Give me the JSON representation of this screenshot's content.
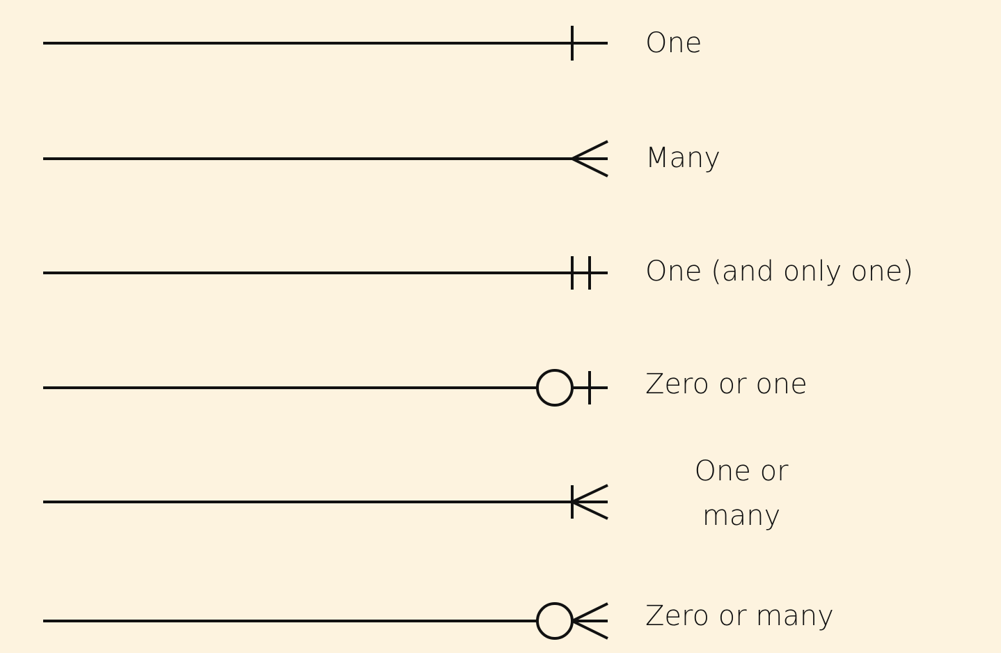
{
  "legend": {
    "colors": {
      "background": "#fdf3df",
      "stroke": "#111111"
    },
    "rows": [
      {
        "symbol": "one",
        "label": "One"
      },
      {
        "symbol": "many",
        "label": "Many"
      },
      {
        "symbol": "one-and-only-one",
        "label": "One (and only one)"
      },
      {
        "symbol": "zero-or-one",
        "label": "Zero or one"
      },
      {
        "symbol": "one-or-many",
        "label_line1": "One or",
        "label_line2": "many"
      },
      {
        "symbol": "zero-or-many",
        "label": "Zero or many"
      }
    ]
  }
}
